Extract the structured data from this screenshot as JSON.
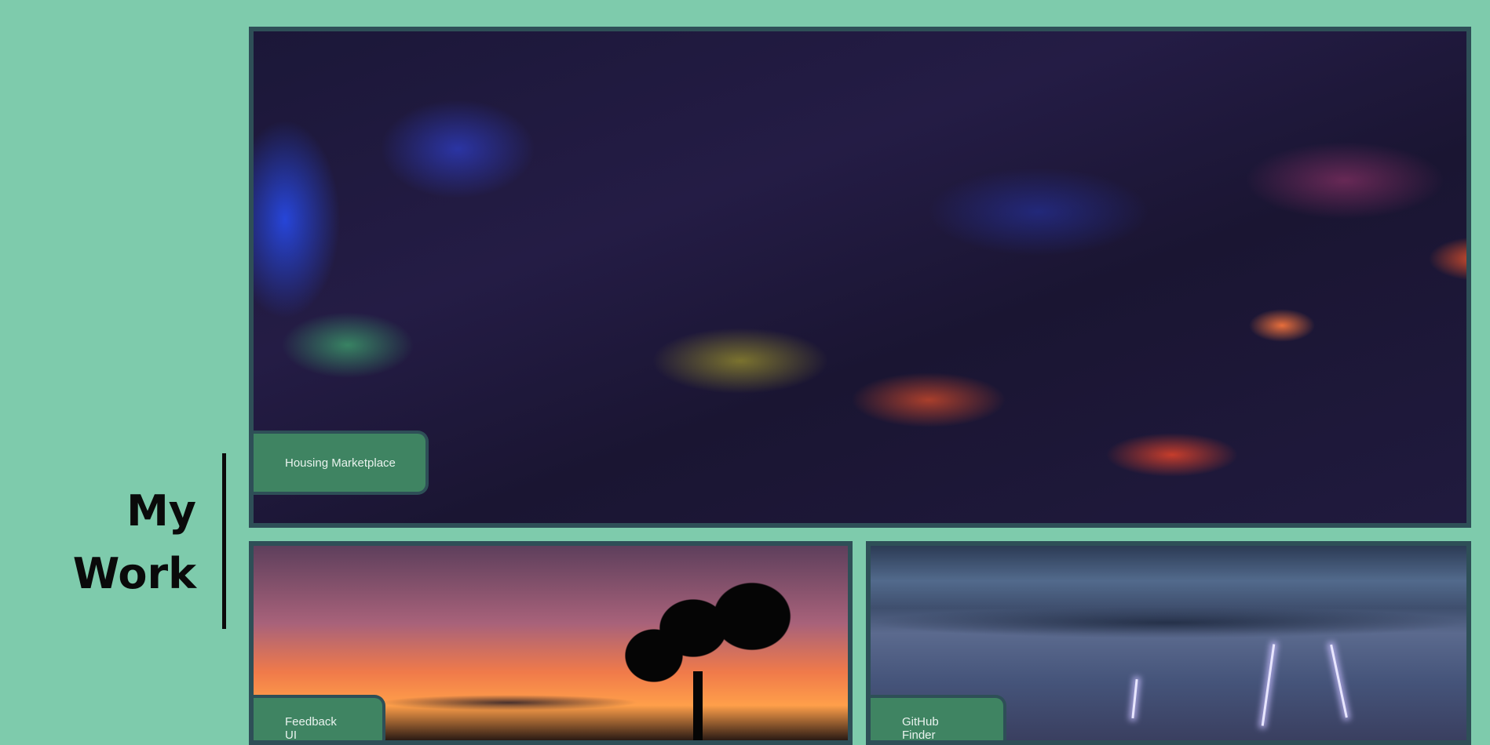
{
  "heading": {
    "line1": "My",
    "line2": "Work"
  },
  "projects": [
    {
      "title": "Housing Marketplace"
    },
    {
      "title": "Feedback UI"
    },
    {
      "title": "GitHub Finder"
    }
  ],
  "colors": {
    "background": "#7ecbac",
    "card_border": "#2e4f57",
    "label_bg": "#3f8462",
    "label_text": "#e9f3ee",
    "heading_text": "#0a0a0a"
  }
}
